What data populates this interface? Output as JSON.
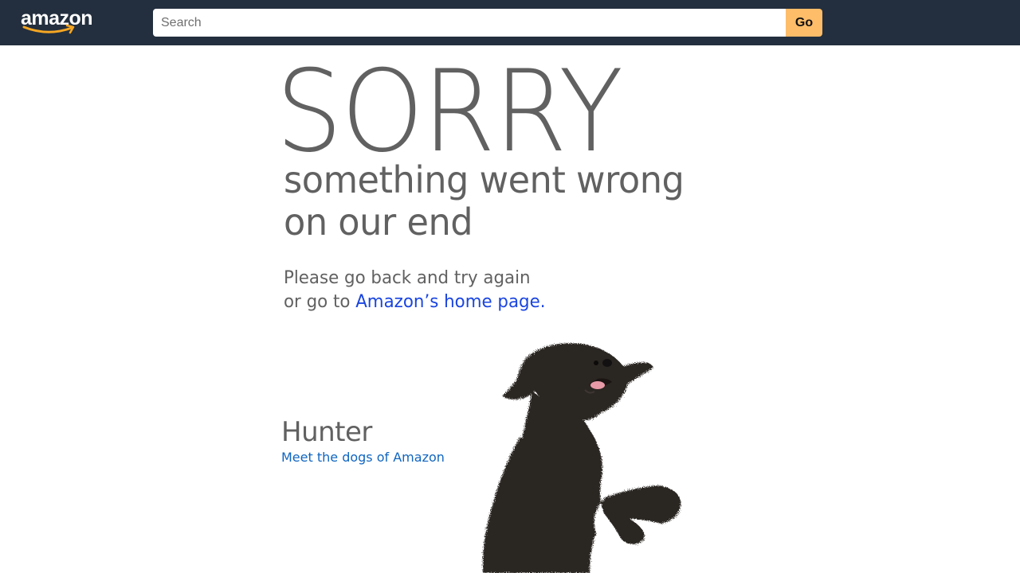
{
  "header": {
    "logo_text": "amazon",
    "search": {
      "placeholder": "Search",
      "value": ""
    },
    "go_label": "Go",
    "colors": {
      "bar": "#232f3e",
      "go_button": "#febd69",
      "smile": "#f5a623"
    }
  },
  "error": {
    "title": "SORRY",
    "subtitle_line1": "something went wrong",
    "subtitle_line2": "on our end",
    "message_line1": "Please go back and try again",
    "message_line2_prefix": "or go to ",
    "home_link": "Amazon’s home page."
  },
  "dog": {
    "name": "Hunter",
    "link": "Meet the dogs of Amazon"
  }
}
